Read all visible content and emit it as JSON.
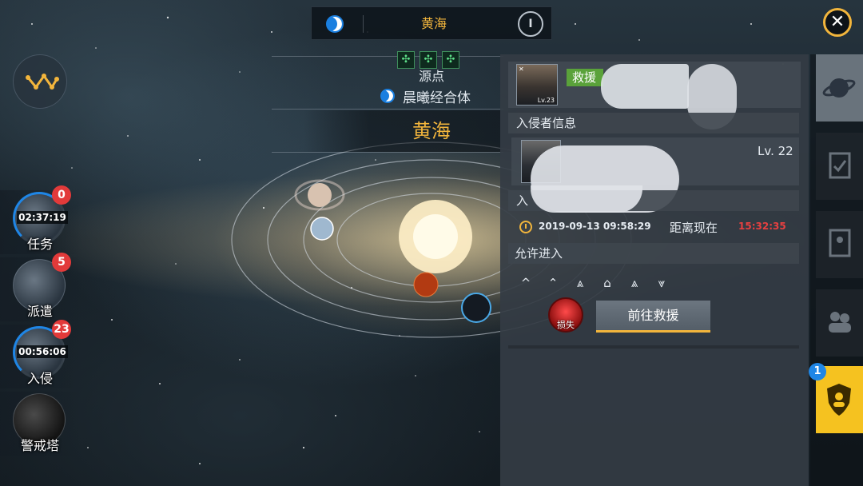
{
  "header": {
    "title": "黄海",
    "compass_label": "I"
  },
  "map": {
    "origin_label": "源点",
    "alliance_name": "晨曦经合体",
    "system_name": "黄海",
    "buff_icons": [
      "buff-icon",
      "buff-icon",
      "buff-icon"
    ]
  },
  "side_menu": [
    {
      "label": "任务",
      "timer": "02:37:19",
      "badge": "0"
    },
    {
      "label": "派遣",
      "timer": "",
      "badge": "5"
    },
    {
      "label": "入侵",
      "timer": "00:56:06",
      "badge": "23"
    },
    {
      "label": "警戒塔",
      "timer": "",
      "badge": ""
    }
  ],
  "panel": {
    "rescue_tag": "救援",
    "avatar_level": "Lv.23",
    "invader_section_title": "入侵者信息",
    "invader_level": "Lv. 22",
    "invasion_section_title_partial": "入",
    "time_value": "2019-09-13 09:58:29",
    "distance_label": "距离现在",
    "countdown": "15:32:35",
    "allow_entry_label": "允许进入",
    "rank_icons": [
      "^",
      "⌃",
      "⩓",
      "⌂",
      "⩓",
      "⩔"
    ],
    "loss_label": "损失",
    "go_rescue_label": "前往救援"
  },
  "tabs": {
    "badge": "1"
  },
  "colors": {
    "accent": "#f2b53c",
    "alert": "#e84040",
    "blue": "#1f86e6",
    "rescue_green": "#5aa23a"
  }
}
